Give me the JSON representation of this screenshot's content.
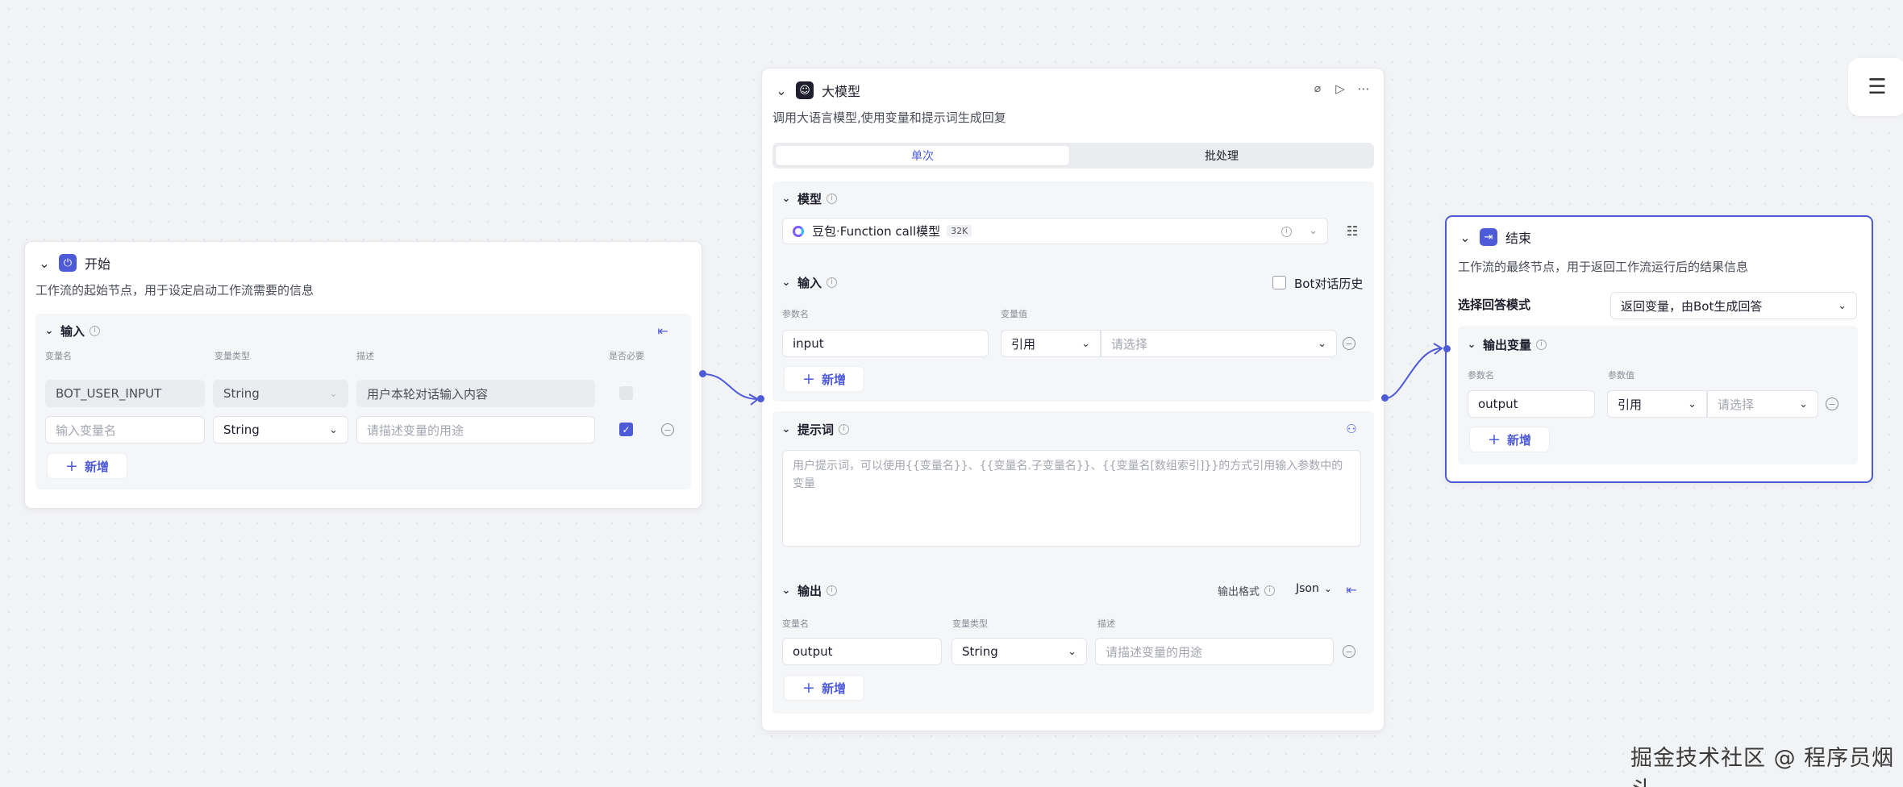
{
  "start": {
    "title": "开始",
    "description": "工作流的起始节点，用于设定启动工作流需要的信息",
    "input_section": {
      "title": "输入",
      "columns": [
        "变量名",
        "变量类型",
        "描述",
        "是否必要"
      ],
      "rows": [
        {
          "name": "BOT_USER_INPUT",
          "type": "String",
          "description": "用户本轮对话输入内容",
          "required": true
        },
        {
          "name_placeholder": "输入变量名",
          "type": "String",
          "description_placeholder": "请描述变量的用途",
          "required": true
        }
      ],
      "add_label": "新增"
    }
  },
  "llm": {
    "title": "大模型",
    "description": "调用大语言模型,使用变量和提示词生成回复",
    "tabs": [
      "单次",
      "批处理"
    ],
    "active_tab": "单次",
    "model_section": {
      "title": "模型",
      "model_name": "豆包·Function call模型",
      "badge": "32K"
    },
    "input_section": {
      "title": "输入",
      "bot_history_label": "Bot对话历史",
      "columns": [
        "参数名",
        "变量值"
      ],
      "param_name": "input",
      "ref_label": "引用",
      "value_placeholder": "请选择",
      "add_label": "新增"
    },
    "prompt_section": {
      "title": "提示词",
      "placeholder": "用户提示词，可以使用{{变量名}}、{{变量名.子变量名}}、{{变量名[数组索引]}}的方式引用输入参数中的变量"
    },
    "output_section": {
      "title": "输出",
      "format_label": "输出格式",
      "format_value": "Json",
      "columns": [
        "变量名",
        "变量类型",
        "描述"
      ],
      "var_name": "output",
      "var_type": "String",
      "description_placeholder": "请描述变量的用途",
      "add_label": "新增"
    }
  },
  "end": {
    "title": "结束",
    "description": "工作流的最终节点，用于返回工作流运行后的结果信息",
    "answer_mode_label": "选择回答模式",
    "answer_mode_value": "返回变量，由Bot生成回答",
    "output_section": {
      "title": "输出变量",
      "columns": [
        "参数名",
        "参数值"
      ],
      "param_name": "output",
      "ref_label": "引用",
      "value_placeholder": "请选择",
      "add_label": "新增"
    }
  },
  "watermark": "掘金技术社区 @ 程序员烟斗",
  "colors": {
    "accent": "#4e5bd8",
    "canvas": "#f2f3f5"
  },
  "icons": [
    "chevron-down-icon",
    "start-node-icon",
    "llm-node-icon",
    "end-node-icon",
    "info-icon",
    "export-icon",
    "debug-icon",
    "run-icon",
    "more-icon",
    "settings-icon",
    "user-icon",
    "minus-circle-icon",
    "plus-icon",
    "panel-toggle-icon"
  ]
}
